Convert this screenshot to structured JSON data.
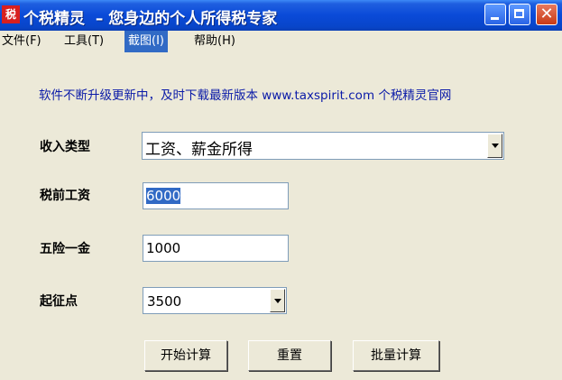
{
  "window": {
    "app_icon_char": "税",
    "title": "个税精灵  – 您身边的个人所得税专家"
  },
  "menubar": {
    "items": [
      "文件(F)",
      "工具(T)",
      "截图(I)",
      "帮助(H)"
    ],
    "active_index": 2
  },
  "notice": "软件不断升级更新中，及时下载最新版本 www.taxspirit.com 个税精灵官网",
  "form": {
    "income_type_label": "收入类型",
    "income_type_value": "工资、薪金所得",
    "pretax_salary_label": "税前工资",
    "pretax_salary_value": "6000",
    "insurance_label": "五险一金",
    "insurance_value": "1000",
    "threshold_label": "起征点",
    "threshold_value": "3500"
  },
  "buttons": {
    "calculate": "开始计算",
    "reset": "重置",
    "batch": "批量计算"
  },
  "colors": {
    "titlebar": "#0a4ad8",
    "menu_active": "#316ac5",
    "notice_text": "#0a1aa8",
    "window_bg": "#ece9d8"
  }
}
